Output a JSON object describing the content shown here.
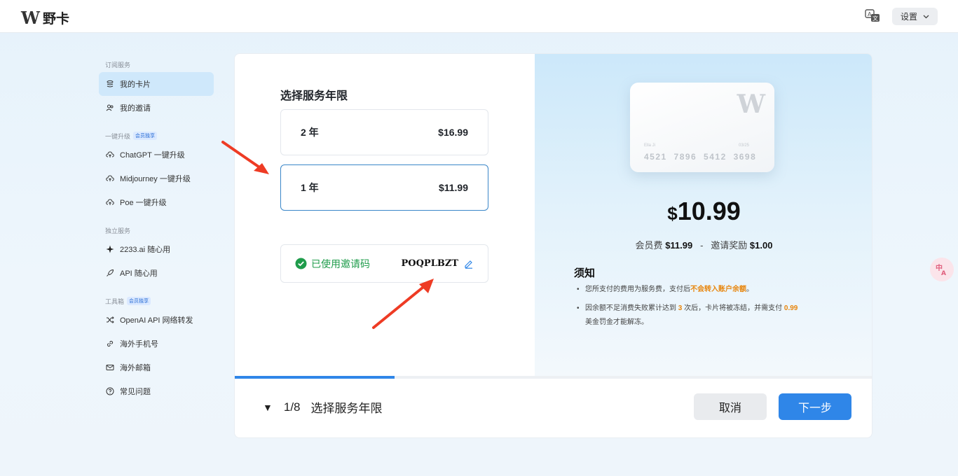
{
  "header": {
    "logo_mark": "W",
    "brand_name": "野卡",
    "settings_label": "设置"
  },
  "sidebar": {
    "sections": [
      {
        "title": "订阅服务",
        "items": [
          {
            "label": "我的卡片",
            "icon": "card-stack-icon",
            "active": true
          },
          {
            "label": "我的邀请",
            "icon": "people-icon"
          }
        ]
      },
      {
        "title": "一键升级",
        "badge": "会员独享",
        "items": [
          {
            "label": "ChatGPT 一键升级",
            "icon": "cloud-upload-icon"
          },
          {
            "label": "Midjourney 一键升级",
            "icon": "cloud-upload-icon"
          },
          {
            "label": "Poe 一键升级",
            "icon": "cloud-upload-icon"
          }
        ]
      },
      {
        "title": "独立服务",
        "items": [
          {
            "label": "2233.ai 随心用",
            "icon": "sparkle-icon"
          },
          {
            "label": "API 随心用",
            "icon": "rocket-icon"
          }
        ]
      },
      {
        "title": "工具箱",
        "badge": "会员独享",
        "items": [
          {
            "label": "OpenAI API 网络转发",
            "icon": "shuffle-icon"
          },
          {
            "label": "海外手机号",
            "icon": "link-icon"
          },
          {
            "label": "海外邮箱",
            "icon": "mail-icon"
          },
          {
            "label": "常见问题",
            "icon": "question-icon"
          }
        ]
      }
    ]
  },
  "main": {
    "section_title": "选择服务年限",
    "options": [
      {
        "label": "2 年",
        "price": "$16.99",
        "selected": false
      },
      {
        "label": "1 年",
        "price": "$11.99",
        "selected": true
      }
    ],
    "invite": {
      "status": "已使用邀请码",
      "code": "POQPLBZT"
    }
  },
  "summary": {
    "card": {
      "holder": "Ella Ji",
      "expiry": "03/25",
      "number": "4521 7896 5412 3698"
    },
    "price_currency": "$",
    "price_amount": "10.99",
    "fee_label": "会员费",
    "fee_value": "$11.99",
    "separator": "-",
    "reward_label": "邀请奖励",
    "reward_value": "$1.00",
    "notice_title": "须知",
    "notice_1_pre": "您所支付的费用为服务费，支付后",
    "notice_1_hl": "不会转入账户余额",
    "notice_1_post": "。",
    "notice_2_pre": "因余额不足消费失败累计达到",
    "notice_2_hl1": "3",
    "notice_2_mid": "次后，卡片将被冻结，并需支付",
    "notice_2_hl2": "0.99",
    "notice_2_post": "美金罚金才能解冻。"
  },
  "footer": {
    "step_counter": "1/8",
    "step_title": "选择服务年限",
    "progress": 0.25,
    "cancel_label": "取消",
    "next_label": "下一步"
  },
  "colors": {
    "accent": "#2f86e8",
    "success": "#1f9c4b",
    "highlight": "#e8850c",
    "annotation_arrow": "#ee3b24"
  }
}
